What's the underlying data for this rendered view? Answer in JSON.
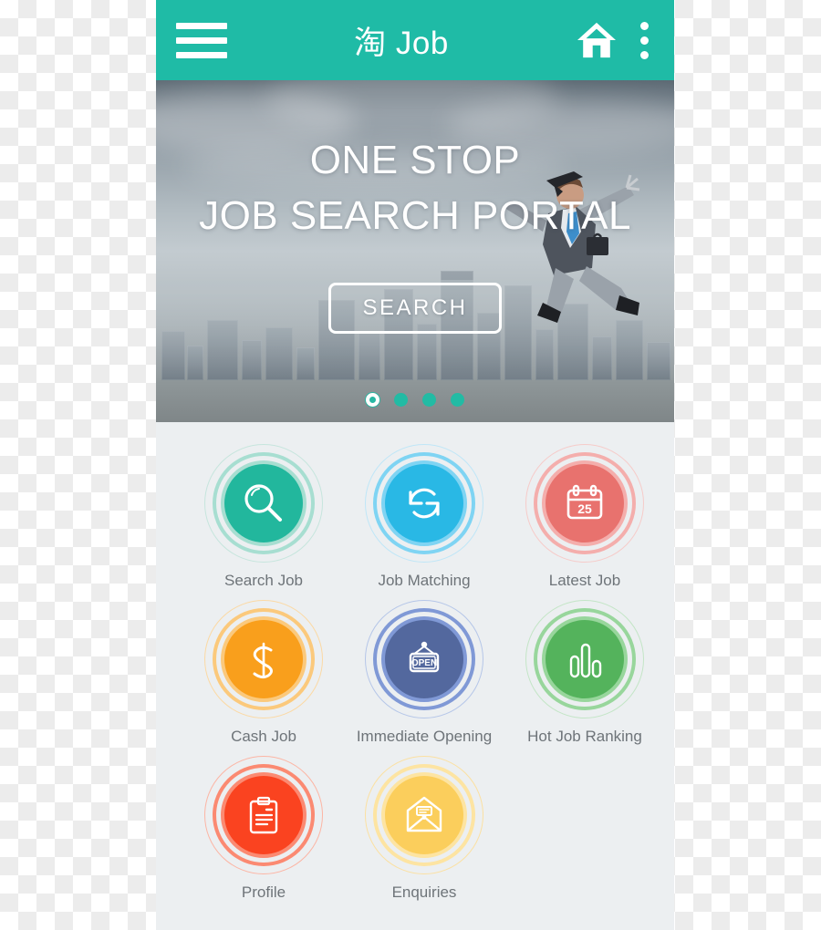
{
  "header": {
    "title": "淘 Job",
    "menu_icon": "hamburger-icon",
    "home_icon": "home-icon",
    "overflow_icon": "kebab-menu-icon",
    "background_color": "#1fbba6"
  },
  "hero": {
    "headline_line1": "ONE STOP",
    "headline_line2": "JOB SEARCH PORTAL",
    "search_button_label": "SEARCH",
    "carousel": {
      "total_dots": 4,
      "active_index": 0,
      "dot_color": "#22bba4"
    }
  },
  "grid": {
    "tiles": [
      {
        "label": "Search Job",
        "icon": "magnifier-icon",
        "core_color": "#22b79d",
        "ring_color": "#a7ded1"
      },
      {
        "label": "Job Matching",
        "icon": "refresh-icon",
        "core_color": "#29b8e5",
        "ring_color": "#7fd4f3"
      },
      {
        "label": "Latest Job",
        "icon": "calendar-icon",
        "core_color": "#e8726e",
        "ring_color": "#f4aeac",
        "badge_text": "25"
      },
      {
        "label": "Cash Job",
        "icon": "dollar-icon",
        "core_color": "#f99f1c",
        "ring_color": "#fbc97c"
      },
      {
        "label": "Immediate Opening",
        "icon": "open-sign-icon",
        "core_color": "#53689e",
        "ring_color": "#8099d6",
        "sign_text": "OPEN"
      },
      {
        "label": "Hot Job Ranking",
        "icon": "bar-chart-icon",
        "core_color": "#54b35c",
        "ring_color": "#98d69c"
      },
      {
        "label": "Profile",
        "icon": "clipboard-icon",
        "core_color": "#fa4320",
        "ring_color": "#fb8a72"
      },
      {
        "label": "Enquiries",
        "icon": "envelope-icon",
        "core_color": "#fbce5c",
        "ring_color": "#fde4a2"
      }
    ]
  },
  "theme": {
    "panel_background": "#eceff1",
    "label_color": "#6e7479"
  }
}
